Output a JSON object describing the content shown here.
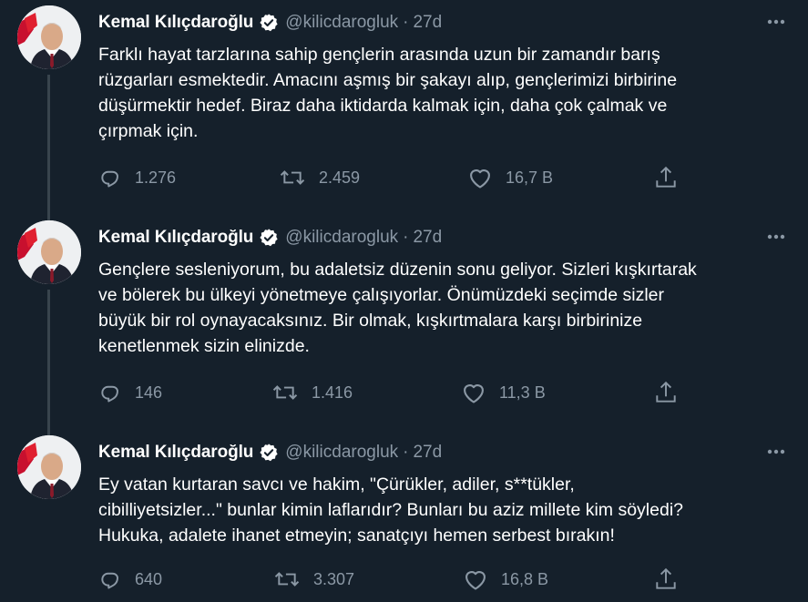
{
  "tweets": [
    {
      "name": "Kemal Kılıçdaroğlu",
      "handle": "@kilicdarogluk",
      "separator": "·",
      "time": "27d",
      "lines": [
        "Farklı hayat tarzlarına sahip gençlerin arasında uzun bir zamandır barış",
        "rüzgarları esmektedir. Amacını aşmış bir şakayı alıp, gençlerimizi birbirine",
        "düşürmektir hedef. Biraz daha iktidarda kalmak için, daha çok çalmak ve",
        "çırpmak için."
      ],
      "replies": "1.276",
      "retweets": "2.459",
      "likes": "16,7 B"
    },
    {
      "name": "Kemal Kılıçdaroğlu",
      "handle": "@kilicdarogluk",
      "separator": "·",
      "time": "27d",
      "lines": [
        "Gençlere sesleniyorum, bu adaletsiz düzenin sonu geliyor. Sizleri kışkırtarak",
        "ve bölerek bu ülkeyi yönetmeye çalışıyorlar. Önümüzdeki seçimde sizler",
        "büyük bir rol oynayacaksınız. Bir olmak, kışkırtmalara karşı birbirinize",
        "kenetlenmek sizin elinizde."
      ],
      "replies": "146",
      "retweets": "1.416",
      "likes": "11,3 B"
    },
    {
      "name": "Kemal Kılıçdaroğlu",
      "handle": "@kilicdarogluk",
      "separator": "·",
      "time": "27d",
      "lines": [
        "Ey vatan kurtaran savcı ve hakim, \"Çürükler, adiler, s**tükler,",
        "cibilliyetsizler...\" bunlar kimin laflarıdır? Bunları bu aziz millete kim söyledi?",
        "Hukuka, adalete ihanet etmeyin; sanatçıyı hemen serbest bırakın!"
      ],
      "replies": "640",
      "retweets": "3.307",
      "likes": "16,8 B"
    }
  ],
  "icons": {
    "avatar": "portrait-avatar",
    "verified": "verified-badge-icon",
    "more": "more-horizontal-icon",
    "reply": "reply-icon",
    "retweet": "retweet-icon",
    "like": "heart-icon",
    "share": "share-icon"
  },
  "colors": {
    "background": "#15202b",
    "text": "#ffffff",
    "muted": "#8b98a5",
    "thread_line": "#38444d",
    "verified_badge": "#ffffff"
  }
}
